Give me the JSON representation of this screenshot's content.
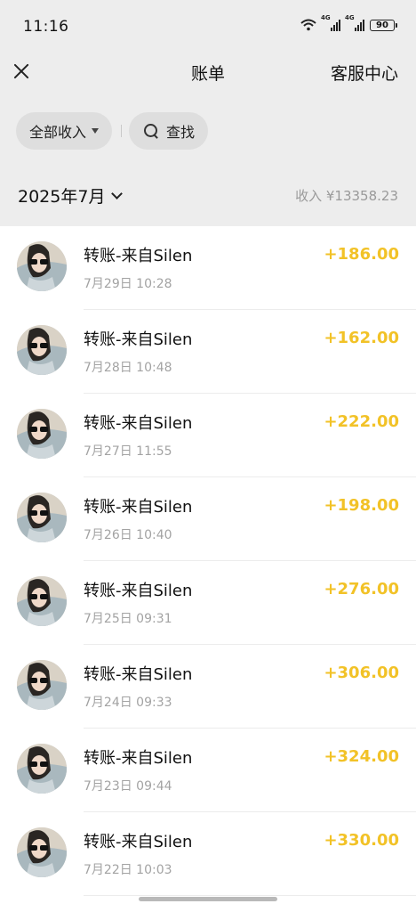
{
  "status_bar": {
    "time": "11:16",
    "signal_1_label": "4G",
    "signal_2_label": "4G",
    "battery": "90"
  },
  "header": {
    "title": "账单",
    "service": "客服中心"
  },
  "filters": {
    "income_filter": "全部收入",
    "search": "查找"
  },
  "summary": {
    "month": "2025年7月",
    "income": "收入 ¥13358.23"
  },
  "transactions": [
    {
      "title": "转账-来自Silen",
      "date": "7月29日 10:28",
      "amount": "+186.00"
    },
    {
      "title": "转账-来自Silen",
      "date": "7月28日 10:48",
      "amount": "+162.00"
    },
    {
      "title": "转账-来自Silen",
      "date": "7月27日 11:55",
      "amount": "+222.00"
    },
    {
      "title": "转账-来自Silen",
      "date": "7月26日 10:40",
      "amount": "+198.00"
    },
    {
      "title": "转账-来自Silen",
      "date": "7月25日 09:31",
      "amount": "+276.00"
    },
    {
      "title": "转账-来自Silen",
      "date": "7月24日 09:33",
      "amount": "+306.00"
    },
    {
      "title": "转账-来自Silen",
      "date": "7月23日 09:44",
      "amount": "+324.00"
    },
    {
      "title": "转账-来自Silen",
      "date": "7月22日 10:03",
      "amount": "+330.00"
    }
  ],
  "colors": {
    "amount": "#f2c227",
    "header_bg": "#ededed"
  }
}
